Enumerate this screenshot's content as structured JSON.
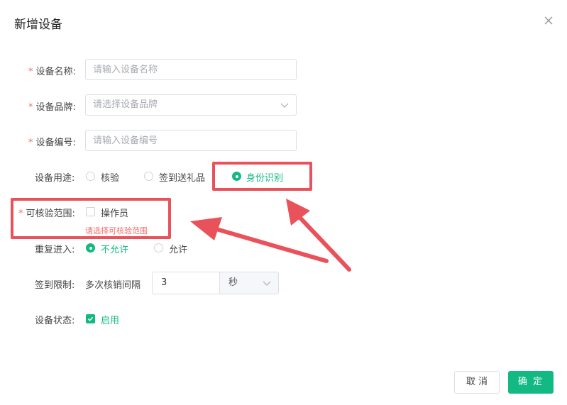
{
  "dialog": {
    "title": "新增设备",
    "close_icon": "close-icon"
  },
  "form": {
    "required_mark": "*",
    "device_name": {
      "label": "设备名称:",
      "placeholder": "请输入设备名称"
    },
    "device_brand": {
      "label": "设备品牌:",
      "placeholder": "请选择设备品牌"
    },
    "device_number": {
      "label": "设备编号:",
      "placeholder": "请输入设备编号"
    },
    "device_usage": {
      "label": "设备用途:",
      "options": [
        "核验",
        "签到送礼品",
        "身份识别"
      ],
      "selected": "身份识别"
    },
    "verify_scope": {
      "label": "可核验范围:",
      "option": "操作员",
      "checked": false,
      "error": "请选择可核验范围"
    },
    "repeat_entry": {
      "label": "重复进入:",
      "options": [
        "不允许",
        "允许"
      ],
      "selected": "不允许"
    },
    "checkin_limit": {
      "label": "签到限制:",
      "prefix": "多次核销间隔",
      "value": "3",
      "unit": "秒"
    },
    "device_status": {
      "label": "设备状态:",
      "option": "启用",
      "checked": true
    }
  },
  "footer": {
    "cancel_label": "取 消",
    "ok_label": "确 定"
  },
  "colors": {
    "accent": "#13b983",
    "error": "#f56c6c",
    "annotation": "#e9525a"
  }
}
